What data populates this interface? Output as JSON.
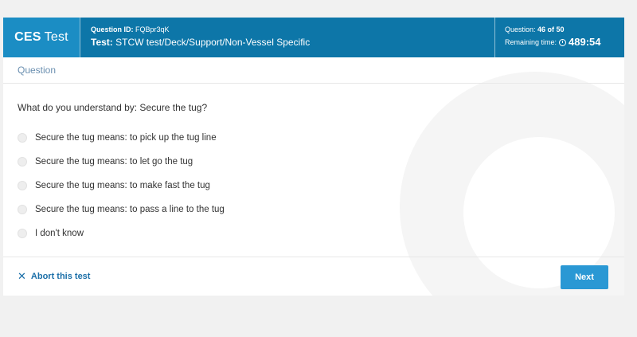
{
  "header": {
    "brand_bold": "CES",
    "brand_rest": "Test",
    "question_id_label": "Question ID:",
    "question_id": "FQBpr3qK",
    "test_label": "Test:",
    "test_path": "STCW test/Deck/Support/Non-Vessel Specific",
    "progress_label": "Question:",
    "progress": "46 of 50",
    "remaining_label": "Remaining time:",
    "remaining_time": "489:54"
  },
  "section": {
    "label": "Question"
  },
  "question": {
    "text": "What do you understand by: Secure the tug?"
  },
  "options": [
    "Secure the tug means: to pick up the tug line",
    "Secure the tug means: to let go the tug",
    "Secure the tug means: to make fast the tug",
    "Secure the tug means: to pass a line to the tug",
    "I don't know"
  ],
  "footer": {
    "abort_label": "Abort this test",
    "next_label": "Next"
  },
  "colors": {
    "header_bg": "#0d76a8",
    "brand_bg": "#1b8dc4",
    "accent": "#2a98d4",
    "link": "#1b6fa8"
  },
  "icons": {
    "abort": "close-icon",
    "timer": "clock-icon"
  }
}
